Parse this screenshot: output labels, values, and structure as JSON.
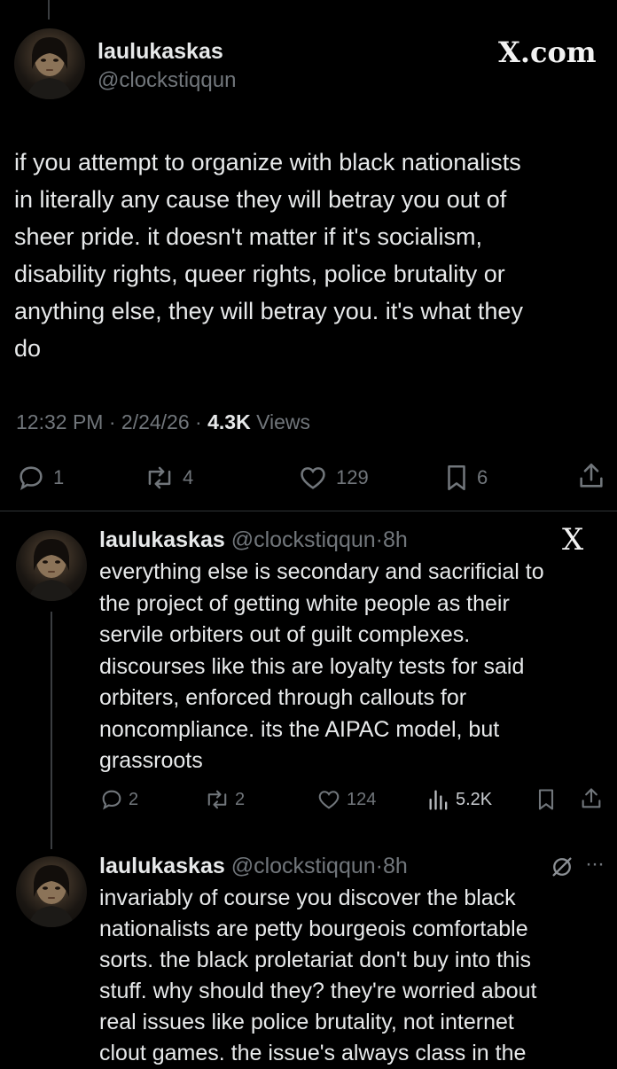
{
  "main_tweet": {
    "display_name": "laulukaskas",
    "handle": "@clockstiqqun",
    "site": "X.com",
    "text_lines": [
      "if you attempt to organize with black nationalists",
      "in literally any cause they will betray you out of",
      "sheer pride. it doesn't matter if it's socialism,",
      "disability rights, queer rights, police brutality or",
      "anything else, they will betray you. it's what they",
      "do"
    ],
    "meta": {
      "time": "12:32 PM",
      "sep1": "·",
      "date": "2/24/26",
      "sep2": "·",
      "views_count": "4.3K",
      "views_label": "Views"
    },
    "actions": {
      "replies": "1",
      "reposts": "4",
      "likes": "129",
      "bookmarks": "6"
    }
  },
  "reply1": {
    "display_name": "laulukaskas",
    "handle": "@clockstiqqun",
    "sep": "·",
    "age": "8h",
    "text_lines": [
      "everything else is secondary and sacrificial to",
      "the project of getting white people as their",
      "servile orbiters out of guilt complexes.",
      "discourses like this are loyalty tests for said",
      "orbiters, enforced through callouts for",
      "noncompliance. its the AIPAC model, but",
      "grassroots"
    ],
    "actions": {
      "replies": "2",
      "reposts": "2",
      "likes": "124",
      "views": "5.2K"
    }
  },
  "reply2": {
    "display_name": "laulukaskas",
    "handle": "@clockstiqqun",
    "sep": "·",
    "age": "8h",
    "more": "···",
    "text_lines": [
      "invariably of course you discover the black",
      "nationalists are petty bourgeois comfortable",
      "sorts. the black proletariat don't buy into this",
      "stuff. why should they? they're worried about",
      "real issues like police brutality, not internet",
      "clout games. the issue's always class in the"
    ]
  }
}
